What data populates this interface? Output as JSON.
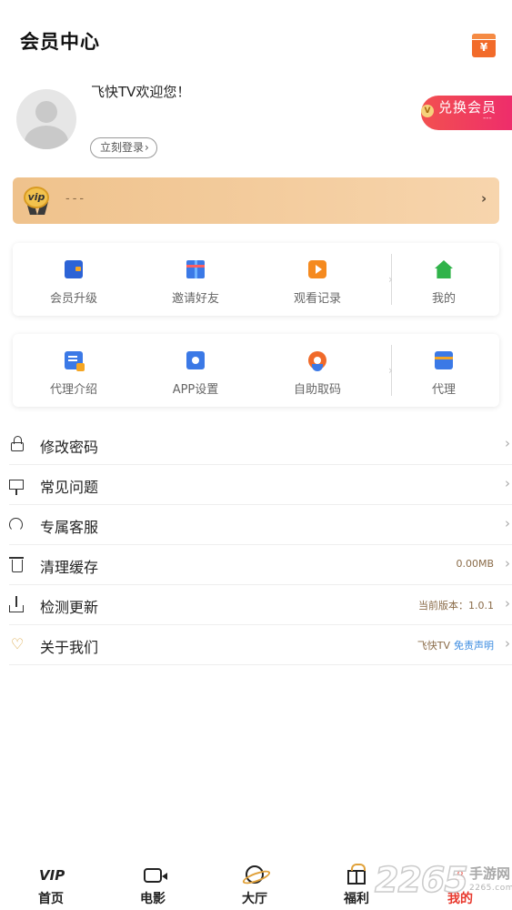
{
  "header": {
    "title": "会员中心",
    "wallet_icon": "wallet-yen-icon",
    "wallet_symbol": "¥"
  },
  "profile": {
    "welcome": "飞快TV欢迎您！",
    "login_label": "立刻登录",
    "login_chevron": "›",
    "redeem_label": "兑换会员",
    "redeem_badge": "V",
    "redeem_sub": "---"
  },
  "vip_bar": {
    "badge_text": "vip",
    "status": "---",
    "arrow": "›"
  },
  "grid1": [
    {
      "label": "会员升级",
      "icon": "wallet-icon"
    },
    {
      "label": "邀请好友",
      "icon": "gift-icon"
    },
    {
      "label": "观看记录",
      "icon": "tv-play-icon"
    },
    {
      "label": "我的",
      "icon": "home-icon"
    }
  ],
  "grid2": [
    {
      "label": "代理介绍",
      "icon": "document-icon"
    },
    {
      "label": "APP设置",
      "icon": "folder-user-icon"
    },
    {
      "label": "自助取码",
      "icon": "flower-icon"
    },
    {
      "label": "代理",
      "icon": "card-icon"
    }
  ],
  "menu": [
    {
      "label": "修改密码",
      "icon": "lock-icon",
      "value": ""
    },
    {
      "label": "常见问题",
      "icon": "board-icon",
      "value": ""
    },
    {
      "label": "专属客服",
      "icon": "headset-icon",
      "value": ""
    },
    {
      "label": "清理缓存",
      "icon": "trash-icon",
      "value": "0.00MB"
    },
    {
      "label": "检测更新",
      "icon": "download-icon",
      "value": "当前版本：1.0.1"
    },
    {
      "label": "关于我们",
      "icon": "heart-icon",
      "value": "飞快TV",
      "link": "免责声明"
    }
  ],
  "menu_chevron": "›",
  "tabbar": [
    {
      "label": "首页",
      "icon": "vip-icon",
      "glyph": "VIP",
      "active": false
    },
    {
      "label": "电影",
      "icon": "camera-icon",
      "active": false
    },
    {
      "label": "大厅",
      "icon": "planet-icon",
      "active": false
    },
    {
      "label": "福利",
      "icon": "gift-icon",
      "active": false
    },
    {
      "label": "我的",
      "icon": "user-icon",
      "glyph": "♙",
      "active": true
    }
  ],
  "watermark": {
    "number": "2265",
    "text": "手游网",
    "url": "2265.com"
  },
  "colors": {
    "accent": "#e8372c",
    "vip_gold": "#efc28c",
    "redeem_pink": "#ee2d6b",
    "wallet_orange": "#f26b2a"
  }
}
